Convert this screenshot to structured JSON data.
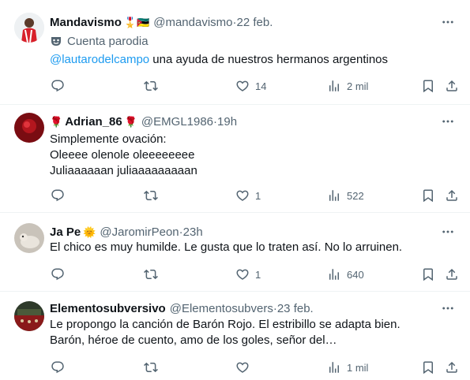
{
  "tweets": [
    {
      "name": "Mandavismo",
      "name_emojis": "🎖️🇲🇿",
      "handle": "@mandavismo",
      "date": "22 feb.",
      "parody_label": "Cuenta parodia",
      "mention": "@lautarodelcampo",
      "text": " una ayuda de nuestros hermanos argentinos",
      "lines": [],
      "replies": "",
      "retweets": "",
      "likes": "14",
      "views": "2 mil"
    },
    {
      "name_prefix_emoji": "🌹",
      "name": "Adrian_86",
      "name_emojis": "🌹",
      "handle": "@EMGL1986",
      "date": "19h",
      "lines": [
        "Simplemente ovación:",
        "Oleeee olenole oleeeeeeee",
        "Juliaaaaaan juliaaaaaaaaan"
      ],
      "replies": "",
      "retweets": "",
      "likes": "1",
      "views": "522"
    },
    {
      "name": "Ja Pe",
      "name_emojis": "🌞",
      "handle": "@JaromirPeon",
      "date": "23h",
      "lines": [
        "El chico es muy humilde. Le gusta que lo traten así. No lo arruinen."
      ],
      "replies": "",
      "retweets": "",
      "likes": "1",
      "views": "640"
    },
    {
      "name": "Elementosubversivo",
      "handle": "@Elementosubvers",
      "date": "23 feb.",
      "lines": [
        "Le propongo la canción de Barón Rojo. El estribillo se adapta bien.",
        "Barón, héroe de cuento, amo de los goles, señor del…"
      ],
      "replies": "",
      "retweets": "",
      "likes": "",
      "views": "1 mil"
    }
  ],
  "separator": " · ",
  "icons": [
    "more-icon",
    "reply-icon",
    "retweet-icon",
    "like-icon",
    "views-icon",
    "bookmark-icon",
    "share-icon",
    "parody-mask-icon"
  ],
  "colors": {
    "text": "#0f1419",
    "secondary": "#536471",
    "mention": "#1d9bf0",
    "divider": "#eff3f4"
  }
}
